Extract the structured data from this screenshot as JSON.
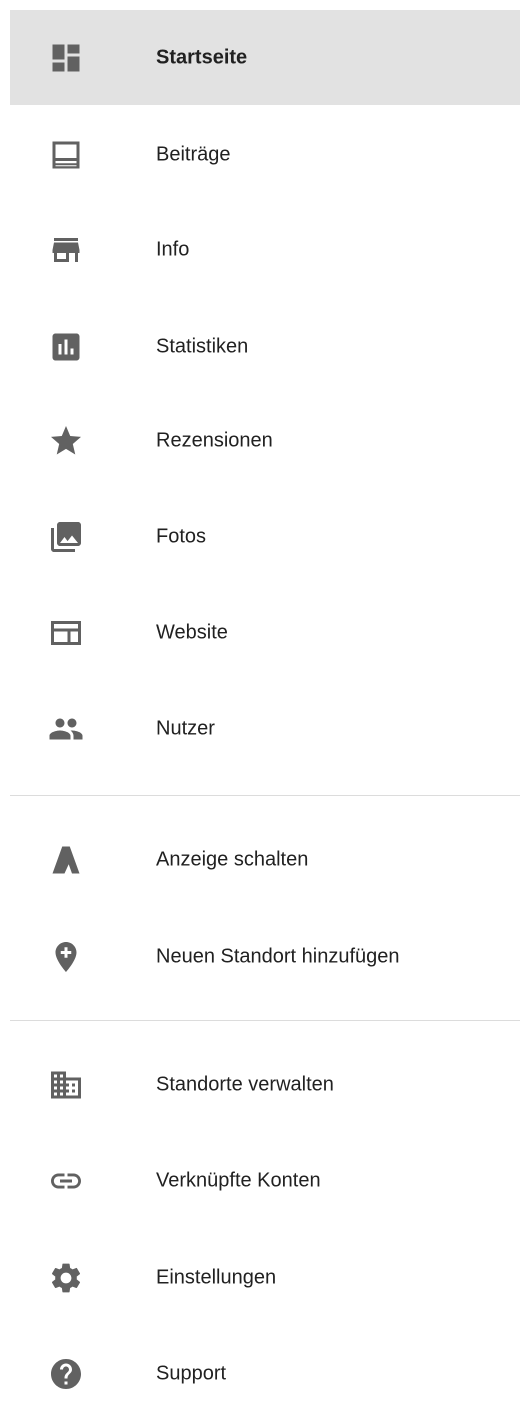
{
  "nav": {
    "items": [
      {
        "label": "Startseite",
        "icon": "dashboard-icon",
        "active": true
      },
      {
        "label": "Beiträge",
        "icon": "posts-icon"
      },
      {
        "label": "Info",
        "icon": "storefront-icon"
      },
      {
        "label": "Statistiken",
        "icon": "insights-icon"
      },
      {
        "label": "Rezensionen",
        "icon": "star-icon"
      },
      {
        "label": "Fotos",
        "icon": "photo-library-icon"
      },
      {
        "label": "Website",
        "icon": "website-icon"
      },
      {
        "label": "Nutzer",
        "icon": "people-icon"
      },
      {
        "label": "Anzeige schalten",
        "icon": "google-ads-icon"
      },
      {
        "label": "Neuen Standort hinzufügen",
        "icon": "add-location-icon"
      },
      {
        "label": "Standorte verwalten",
        "icon": "business-icon"
      },
      {
        "label": "Verknüpfte Konten",
        "icon": "link-icon"
      },
      {
        "label": "Einstellungen",
        "icon": "gear-icon"
      },
      {
        "label": "Support",
        "icon": "help-icon"
      }
    ]
  },
  "colors": {
    "active_background": "#e2e2e2",
    "icon": "#616161",
    "text": "#212121",
    "divider": "#dcdcdc"
  }
}
